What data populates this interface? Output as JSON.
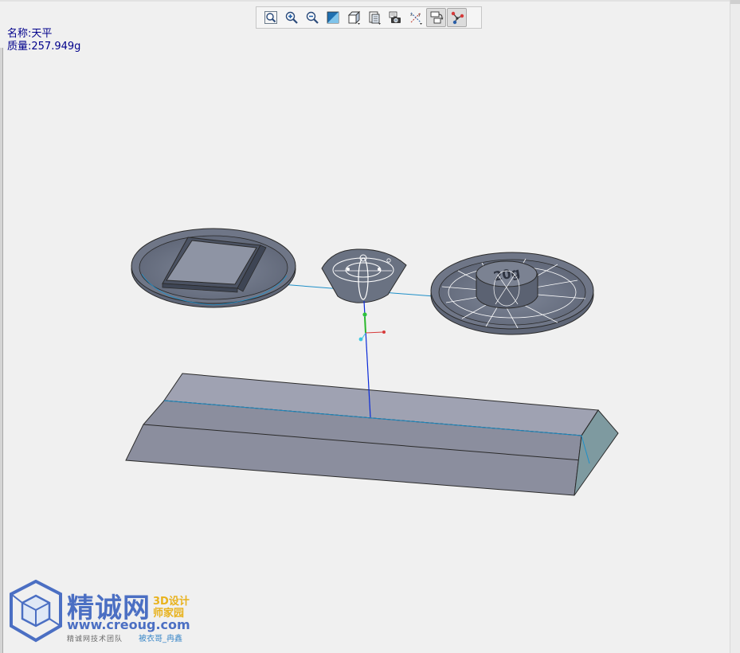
{
  "toolbar": {
    "items": [
      {
        "name": "zoom-fit",
        "icon": "zoom-fit-icon",
        "active": false
      },
      {
        "name": "zoom-in",
        "icon": "zoom-in-icon",
        "active": false
      },
      {
        "name": "zoom-out",
        "icon": "zoom-out-icon",
        "active": false
      },
      {
        "name": "display-style",
        "icon": "shading-icon",
        "active": false
      },
      {
        "name": "saved-views",
        "icon": "cube-view-icon",
        "active": false
      },
      {
        "name": "view-manager",
        "icon": "view-list-icon",
        "active": false
      },
      {
        "name": "screenshot",
        "icon": "camera-icon",
        "active": false
      },
      {
        "name": "datum-display",
        "icon": "datum-axes-icon",
        "active": false
      },
      {
        "name": "spin-center",
        "icon": "spin-center-icon",
        "active": true
      },
      {
        "name": "mechanism-connections",
        "icon": "connections-icon",
        "active": true
      }
    ]
  },
  "info": {
    "name_line": "名称:天平",
    "mass_line": "质量:257.949g"
  },
  "model": {
    "weight_label": "20g",
    "colors": {
      "body": "#8a8d9e",
      "body_dark": "#6c7080",
      "body_light": "#a3a6b4",
      "edge": "#2a2a2a",
      "axis_blue": "#0a2ad8",
      "axis_cyan": "#1e8fc8"
    }
  },
  "watermark": {
    "brand_cn": "精诚网",
    "side_top": "3D设计",
    "side_bottom": "师家园",
    "url": "www.creoug.com",
    "team": "精诚网技术团队",
    "author": "被衣哥_冉鑫"
  }
}
